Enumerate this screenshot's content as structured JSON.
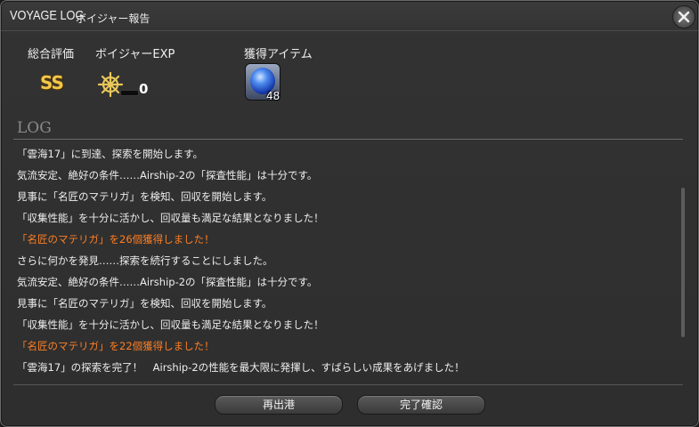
{
  "window": {
    "title": "VOYAGE LOG",
    "subtitle": "ボイジャー報告",
    "close_icon": "close-icon"
  },
  "summary": {
    "rating_label": "総合評価",
    "rating_value": "SS",
    "exp_label": "ボイジャーEXP",
    "exp_icon": "ship-wheel-icon",
    "exp_value": "0",
    "items_label": "獲得アイテム",
    "item_icon": "blue-materia-icon",
    "item_count": "48"
  },
  "log": {
    "title": "LOG",
    "lines": [
      {
        "text": "「雲海17」に到達、探索を開始します。",
        "highlight": false
      },
      {
        "text": "気流安定、絶好の条件……Airship-2の「探査性能」は十分です。",
        "highlight": false
      },
      {
        "text": "見事に「名匠のマテリガ」を検知、回収を開始します。",
        "highlight": false
      },
      {
        "text": "「収集性能」を十分に活かし、回収量も満足な結果となりました！",
        "highlight": false
      },
      {
        "text": "「名匠のマテリガ」を26個獲得しました！",
        "highlight": true
      },
      {
        "text": "さらに何かを発見……探索を続行することにしました。",
        "highlight": false
      },
      {
        "text": "気流安定、絶好の条件……Airship-2の「探査性能」は十分です。",
        "highlight": false
      },
      {
        "text": "見事に「名匠のマテリガ」を検知、回収を開始します。",
        "highlight": false
      },
      {
        "text": "「収集性能」を十分に活かし、回収量も満足な結果となりました！",
        "highlight": false
      },
      {
        "text": "「名匠のマテリガ」を22個獲得しました！",
        "highlight": true
      },
      {
        "text": "「雲海17」の探索を完了！　Airship-2の性能を最大限に発揮し、すばらしい成果をあげました！",
        "highlight": false
      }
    ],
    "highlight_color": "#ff7f24"
  },
  "buttons": {
    "redeploy_label": "再出港",
    "confirm_label": "完了確認"
  }
}
